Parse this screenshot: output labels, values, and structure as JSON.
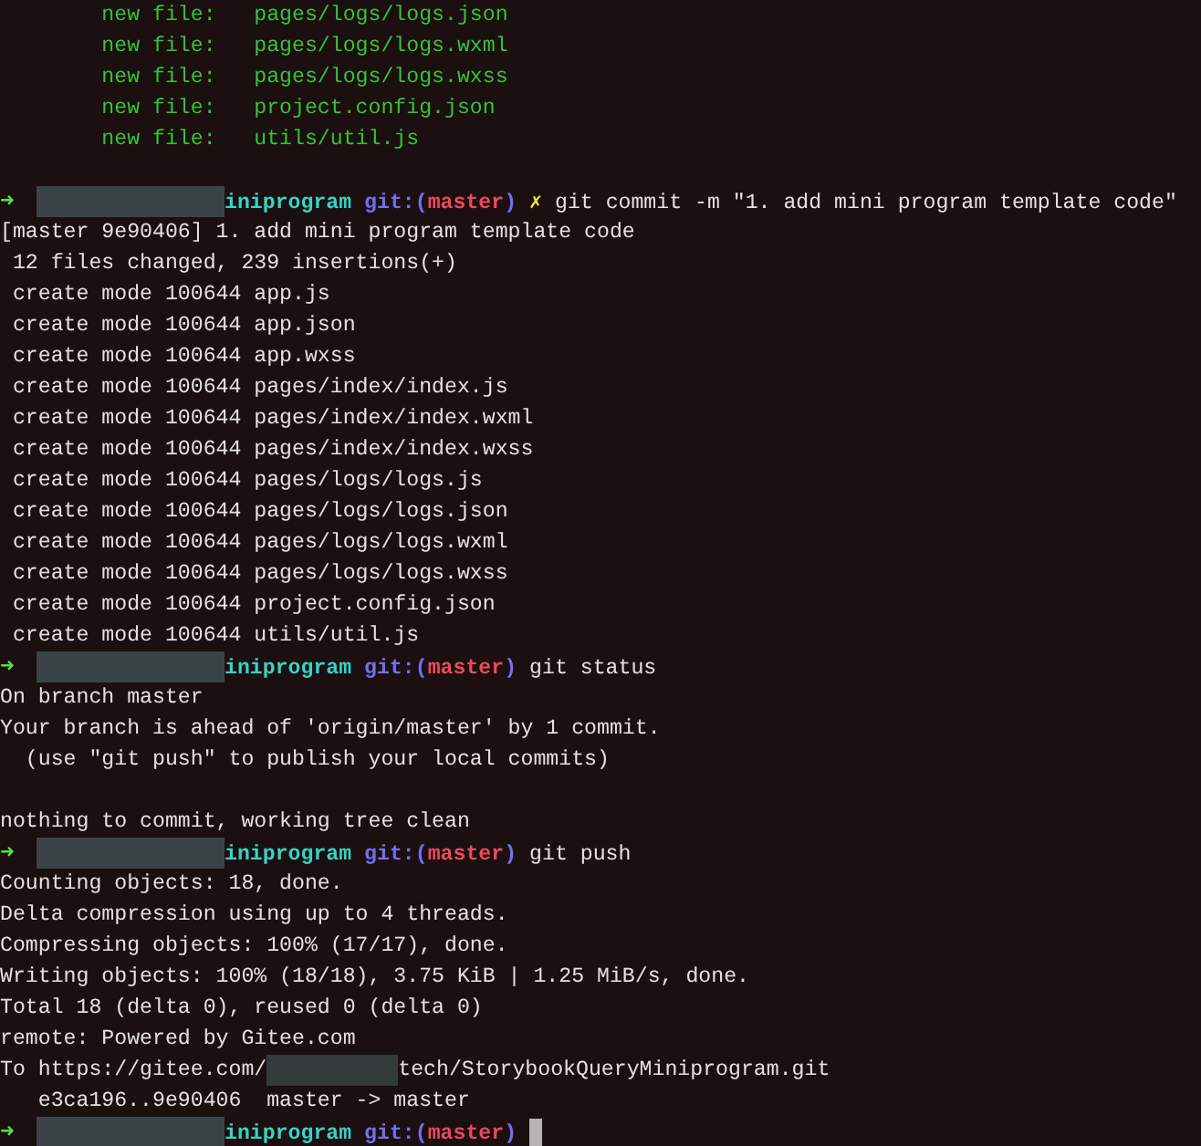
{
  "lines": [
    {
      "kind": "staged",
      "label": "new file:",
      "path": "pages/logs/logs.json"
    },
    {
      "kind": "staged",
      "label": "new file:",
      "path": "pages/logs/logs.wxml"
    },
    {
      "kind": "staged",
      "label": "new file:",
      "path": "pages/logs/logs.wxss"
    },
    {
      "kind": "staged",
      "label": "new file:",
      "path": "project.config.json"
    },
    {
      "kind": "staged",
      "label": "new file:",
      "path": "utils/util.js"
    },
    {
      "kind": "blank"
    },
    {
      "kind": "prompt",
      "arrow": "➜",
      "directory": "iniprogram",
      "git": {
        "prefix": "git:(",
        "branch": "master",
        "suffix": ")"
      },
      "status_mark": "✗",
      "command": "git commit -m \"1. add mini program template code\"",
      "cursor": false
    },
    {
      "kind": "output",
      "text": "[master 9e90406] 1. add mini program template code"
    },
    {
      "kind": "output",
      "text": " 12 files changed, 239 insertions(+)"
    },
    {
      "kind": "output",
      "text": " create mode 100644 app.js"
    },
    {
      "kind": "output",
      "text": " create mode 100644 app.json"
    },
    {
      "kind": "output",
      "text": " create mode 100644 app.wxss"
    },
    {
      "kind": "output",
      "text": " create mode 100644 pages/index/index.js"
    },
    {
      "kind": "output",
      "text": " create mode 100644 pages/index/index.wxml"
    },
    {
      "kind": "output",
      "text": " create mode 100644 pages/index/index.wxss"
    },
    {
      "kind": "output",
      "text": " create mode 100644 pages/logs/logs.js"
    },
    {
      "kind": "output",
      "text": " create mode 100644 pages/logs/logs.json"
    },
    {
      "kind": "output",
      "text": " create mode 100644 pages/logs/logs.wxml"
    },
    {
      "kind": "output",
      "text": " create mode 100644 pages/logs/logs.wxss"
    },
    {
      "kind": "output",
      "text": " create mode 100644 project.config.json"
    },
    {
      "kind": "output",
      "text": " create mode 100644 utils/util.js"
    },
    {
      "kind": "prompt",
      "arrow": "➜",
      "directory": "iniprogram",
      "git": {
        "prefix": "git:(",
        "branch": "master",
        "suffix": ")"
      },
      "command": "git status",
      "cursor": false
    },
    {
      "kind": "output",
      "text": "On branch master"
    },
    {
      "kind": "output",
      "text": "Your branch is ahead of 'origin/master' by 1 commit."
    },
    {
      "kind": "output",
      "text": "  (use \"git push\" to publish your local commits)"
    },
    {
      "kind": "blank"
    },
    {
      "kind": "output",
      "text": "nothing to commit, working tree clean"
    },
    {
      "kind": "prompt",
      "arrow": "➜",
      "directory": "iniprogram",
      "git": {
        "prefix": "git:(",
        "branch": "master",
        "suffix": ")"
      },
      "command": "git push",
      "cursor": false
    },
    {
      "kind": "output",
      "text": "Counting objects: 18, done."
    },
    {
      "kind": "output",
      "text": "Delta compression using up to 4 threads."
    },
    {
      "kind": "output",
      "text": "Compressing objects: 100% (17/17), done."
    },
    {
      "kind": "output",
      "text": "Writing objects: 100% (18/18), 3.75 KiB | 1.25 MiB/s, done."
    },
    {
      "kind": "output",
      "text": "Total 18 (delta 0), reused 0 (delta 0)"
    },
    {
      "kind": "output",
      "text": "remote: Powered by Gitee.com"
    },
    {
      "kind": "redacted",
      "before": "To https://gitee.com/",
      "after": "tech/StorybookQueryMiniprogram.git"
    },
    {
      "kind": "output",
      "text": "   e3ca196..9e90406  master -> master"
    },
    {
      "kind": "prompt",
      "arrow": "➜",
      "directory": "iniprogram",
      "git": {
        "prefix": "git:(",
        "branch": "master",
        "suffix": ")"
      },
      "cursor": true
    }
  ]
}
